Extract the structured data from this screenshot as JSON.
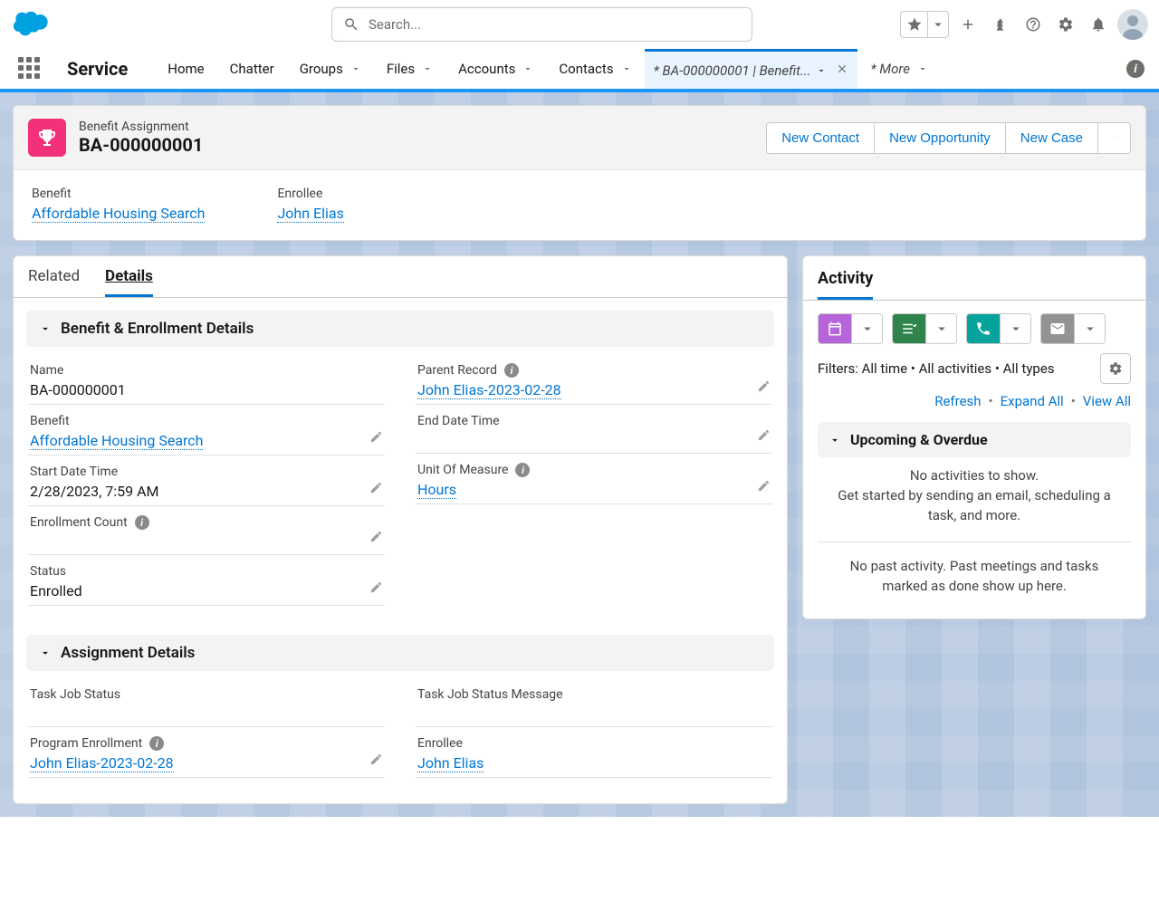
{
  "header": {
    "search_placeholder": "Search..."
  },
  "nav": {
    "app_name": "Service",
    "items": [
      "Home",
      "Chatter",
      "Groups",
      "Files",
      "Accounts",
      "Contacts"
    ],
    "open_tab": "* BA-000000001 | Benefit...",
    "more": "* More"
  },
  "record": {
    "type": "Benefit Assignment",
    "title": "BA-000000001",
    "actions": {
      "a1": "New Contact",
      "a2": "New Opportunity",
      "a3": "New Case"
    },
    "summary": {
      "benefit_lbl": "Benefit",
      "benefit_val": "Affordable Housing Search",
      "enrollee_lbl": "Enrollee",
      "enrollee_val": "John Elias"
    }
  },
  "tabs": {
    "related": "Related",
    "details": "Details"
  },
  "section1": "Benefit & Enrollment Details",
  "section2": "Assignment Details",
  "fields": {
    "name_lbl": "Name",
    "name_val": "BA-000000001",
    "benefit_lbl": "Benefit",
    "benefit_val": "Affordable Housing Search",
    "start_lbl": "Start Date Time",
    "start_val": "2/28/2023, 7:59 AM",
    "enroll_cnt_lbl": "Enrollment Count",
    "enroll_cnt_val": "",
    "status_lbl": "Status",
    "status_val": "Enrolled",
    "parent_lbl": "Parent Record",
    "parent_val": "John Elias-2023-02-28",
    "end_lbl": "End Date Time",
    "end_val": "",
    "uom_lbl": "Unit Of Measure",
    "uom_val": "Hours",
    "taskjob_lbl": "Task Job Status",
    "taskjob_val": "",
    "taskmsg_lbl": "Task Job Status Message",
    "taskmsg_val": "",
    "progenr_lbl": "Program Enrollment",
    "progenr_val": "John Elias-2023-02-28",
    "enrollee2_lbl": "Enrollee",
    "enrollee2_val": "John Elias"
  },
  "activity": {
    "title": "Activity",
    "filters": "Filters: All time • All activities • All types",
    "refresh": "Refresh",
    "expand": "Expand All",
    "viewall": "View All",
    "upcoming": "Upcoming & Overdue",
    "empty1": "No activities to show.",
    "empty2": "Get started by sending an email, scheduling a task, and more.",
    "past": "No past activity. Past meetings and tasks marked as done show up here."
  }
}
